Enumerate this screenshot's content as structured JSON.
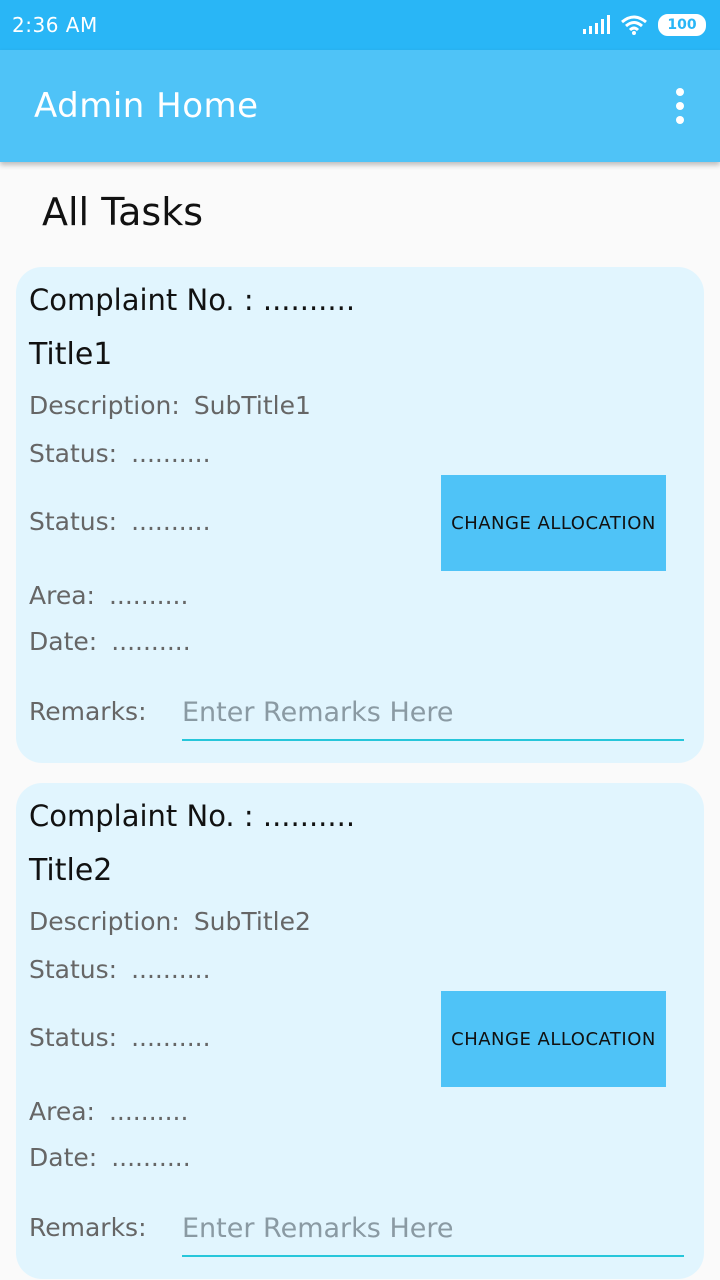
{
  "status_bar": {
    "time": "2:36 AM",
    "battery": "100"
  },
  "app_bar": {
    "title": "Admin Home"
  },
  "section_title": "All Tasks",
  "cards": [
    {
      "complaint": "Complaint No. : ..........",
      "title": "Title1",
      "description_label": "Description:",
      "description_value": "SubTitle1",
      "status1_label": "Status:",
      "status1_value": "..........",
      "status2_label": "Status:",
      "status2_value": "..........",
      "area_label": "Area:",
      "area_value": "..........",
      "date_label": "Date:",
      "date_value": "..........",
      "remarks_label": "Remarks:",
      "remarks_placeholder": "Enter Remarks Here",
      "button_label": "CHANGE ALLOCATION"
    },
    {
      "complaint": "Complaint No. : ..........",
      "title": "Title2",
      "description_label": "Description:",
      "description_value": "SubTitle2",
      "status1_label": "Status:",
      "status1_value": "..........",
      "status2_label": "Status:",
      "status2_value": "..........",
      "area_label": "Area:",
      "area_value": "..........",
      "date_label": "Date:",
      "date_value": "..........",
      "remarks_label": "Remarks:",
      "remarks_placeholder": "Enter Remarks Here",
      "button_label": "CHANGE ALLOCATION"
    }
  ],
  "icons": [
    "signal-icon",
    "wifi-icon",
    "battery-icon",
    "overflow-menu-icon"
  ],
  "colors": {
    "status_bar": "#29b6f6",
    "app_bar": "#4fc3f7",
    "card": "#e1f5fe",
    "button": "#4fc3f7",
    "input_underline": "#26c6da"
  }
}
